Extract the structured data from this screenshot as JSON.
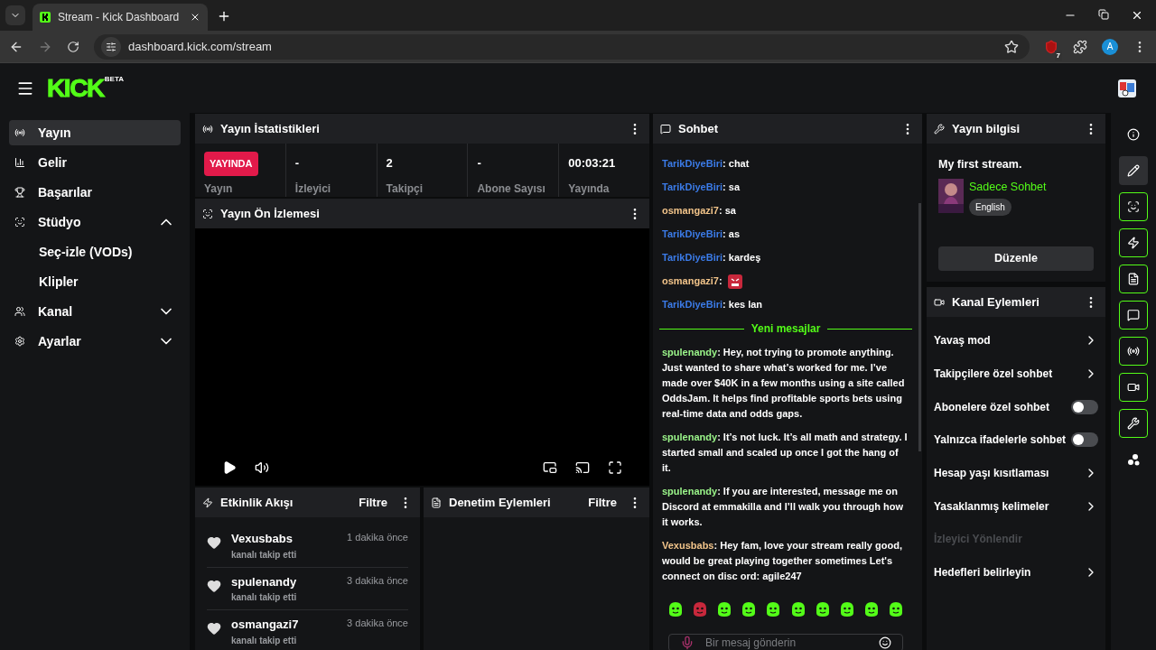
{
  "browser": {
    "tab_title": "Stream - Kick Dashboard",
    "url": "dashboard.kick.com/stream",
    "extension_badge": "7",
    "profile_initial": "A"
  },
  "header": {
    "logo": "KICK",
    "logo_badge": "BETA"
  },
  "sidebar": {
    "items": [
      {
        "label": "Yayın",
        "selected": true
      },
      {
        "label": "Gelir",
        "selected": false
      },
      {
        "label": "Başarılar",
        "selected": false
      },
      {
        "label": "Stüdyo",
        "selected": false,
        "expanded": true,
        "children": [
          {
            "label": "Seç-izle (VODs)",
            "selected": false
          },
          {
            "label": "Klipler",
            "selected": false
          }
        ]
      },
      {
        "label": "Kanal",
        "selected": false,
        "expanded": false
      },
      {
        "label": "Ayarlar",
        "selected": false,
        "expanded": false
      }
    ]
  },
  "stats": {
    "title": "Yayın İstatistikleri",
    "live_badge": "YAYINDA",
    "cells": [
      {
        "label": "Yayın"
      },
      {
        "value": "-",
        "label": "İzleyici"
      },
      {
        "value": "2",
        "label": "Takipçi"
      },
      {
        "value": "-",
        "label": "Abone Sayısı"
      },
      {
        "value": "00:03:21",
        "label": "Yayında"
      }
    ]
  },
  "preview": {
    "title": "Yayın Ön İzlemesi"
  },
  "activity": {
    "title": "Etkinlik Akışı",
    "filter": "Filtre",
    "events": [
      {
        "user": "Vexusbabs",
        "time": "1 dakika önce",
        "action": "kanalı takip etti"
      },
      {
        "user": "spulenandy",
        "time": "3 dakika önce",
        "action": "kanalı takip etti"
      },
      {
        "user": "osmangazi7",
        "time": "3 dakika önce",
        "action": "kanalı takip etti"
      }
    ]
  },
  "moderation": {
    "title": "Denetim Eylemleri",
    "filter": "Filtre"
  },
  "chat": {
    "title": "Sohbet",
    "messages": [
      {
        "kind": "text",
        "user": "TarikDiyeBiri",
        "color": "#3b7be8",
        "text": ": chat"
      },
      {
        "kind": "text",
        "user": "TarikDiyeBiri",
        "color": "#3b7be8",
        "text": ": sa"
      },
      {
        "kind": "text",
        "user": "osmangazi7",
        "color": "#f2c48a",
        "text": ": sa"
      },
      {
        "kind": "text",
        "user": "TarikDiyeBiri",
        "color": "#3b7be8",
        "text": ": as"
      },
      {
        "kind": "text",
        "user": "TarikDiyeBiri",
        "color": "#3b7be8",
        "text": ": kardeş"
      },
      {
        "kind": "emote",
        "user": "osmangazi7",
        "color": "#f2c48a",
        "text": ":"
      },
      {
        "kind": "text",
        "user": "TarikDiyeBiri",
        "color": "#3b7be8",
        "text": ": kes lan"
      },
      {
        "kind": "divider",
        "text": "Yeni mesajlar"
      },
      {
        "kind": "text",
        "user": "spulenandy",
        "color": "#9bf58a",
        "text": ": Hey, not trying to promote anything. Just wanted to share what’s worked for me. I’ve made over $40K in a few months using a site called OddsJam. It helps find profitable sports bets using real-time data and odds gaps."
      },
      {
        "kind": "text",
        "user": "spulenandy",
        "color": "#9bf58a",
        "text": ": It’s not luck. It’s all math and strategy. I started small and scaled up once I got the hang of it."
      },
      {
        "kind": "text",
        "user": "spulenandy",
        "color": "#9bf58a",
        "text": ": If you are interested, message me on Discord at emmakilla and I’ll walk you through how it works."
      },
      {
        "kind": "text",
        "user": "Vexusbabs",
        "color": "#f2c48a",
        "text": ": Hey fam, love your stream really good, would be great playing together sometimes Let's connect on disc ord: agile247"
      }
    ],
    "emotes": [
      {
        "color": "#53fc18"
      },
      {
        "color": "#c8283c"
      },
      {
        "color": "#53fc18"
      },
      {
        "color": "#53fc18"
      },
      {
        "color": "#53fc18"
      },
      {
        "color": "#53fc18"
      },
      {
        "color": "#53fc18"
      },
      {
        "color": "#53fc18"
      },
      {
        "color": "#53fc18"
      },
      {
        "color": "#53fc18"
      }
    ],
    "input_placeholder": "Bir mesaj gönderin"
  },
  "stream_info": {
    "title": "Yayın bilgisi",
    "stream_title": "My first stream.",
    "category": "Sadece Sohbet",
    "language": "English",
    "edit_button": "Düzenle"
  },
  "channel_actions": {
    "title": "Kanal Eylemleri",
    "items": [
      {
        "kind": "link",
        "label": "Yavaş mod"
      },
      {
        "kind": "link",
        "label": "Takipçilere özel sohbet"
      },
      {
        "kind": "toggle",
        "label": "Abonelere özel sohbet",
        "on": false
      },
      {
        "kind": "toggle",
        "label": "Yalnızca ifadelerle sohbet",
        "on": false
      },
      {
        "kind": "link",
        "label": "Hesap yaşı kısıtlaması"
      },
      {
        "kind": "link",
        "label": "Yasaklanmış kelimeler"
      },
      {
        "kind": "disabled",
        "label": "İzleyici Yönlendir"
      },
      {
        "kind": "link",
        "label": "Hedefleri belirleyin"
      }
    ]
  },
  "rail": [
    {
      "kind": "plain"
    },
    {
      "kind": "selected"
    },
    {
      "kind": "outlined"
    },
    {
      "kind": "outlined"
    },
    {
      "kind": "outlined"
    },
    {
      "kind": "outlined"
    },
    {
      "kind": "outlined"
    },
    {
      "kind": "outlined"
    },
    {
      "kind": "outlined"
    },
    {
      "kind": "plain"
    }
  ]
}
